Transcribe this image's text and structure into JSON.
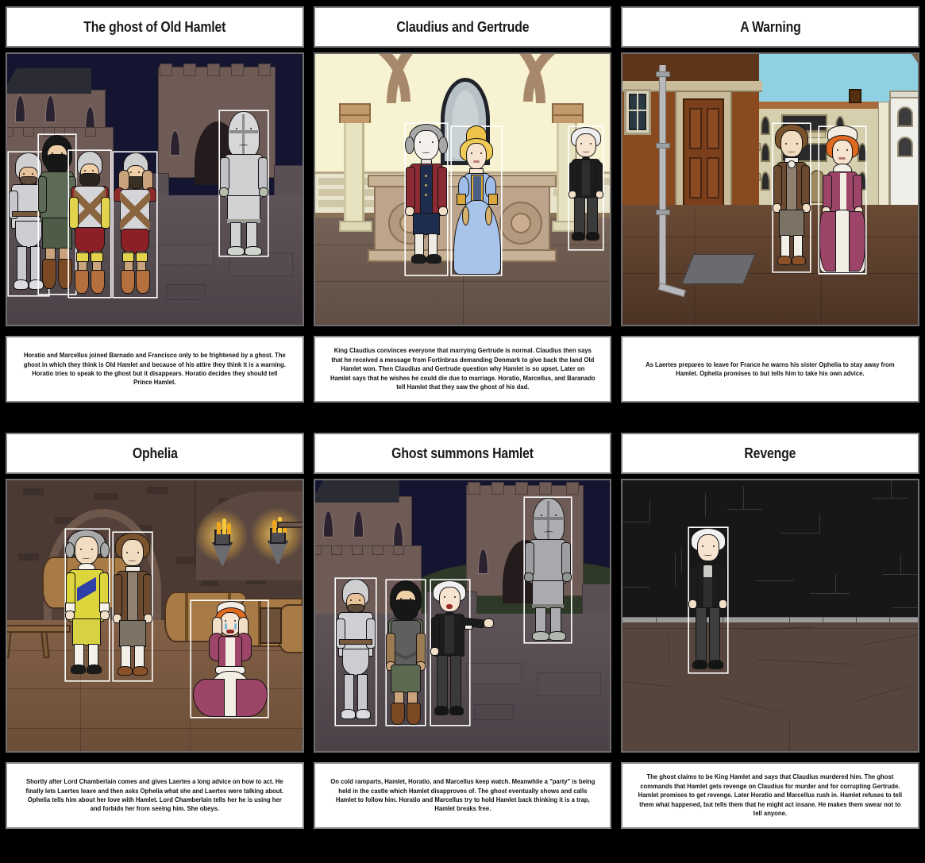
{
  "document": {
    "type": "storyboard",
    "layout": {
      "rows": 2,
      "columns": 3
    },
    "background_color": "#000000",
    "panel_background": "#ffffff"
  },
  "panels": [
    {
      "id": "panel-1",
      "title": "The ghost of Old Hamlet",
      "description": "Horatio and Marcellus joined Barnado and Francisco only to be frightened by a ghost. The ghost in which they think is Old Hamlet and because of his attire they think it is a warning. Horatio tries to speak to the ghost but it disappears. Horatio decides they should tell Prince Hamlet.",
      "scene": {
        "setting": "castle-ramparts-night",
        "sky_color": "#151531",
        "characters": [
          "armored-knight",
          "bearded-guard-green",
          "soldier-red-yellow",
          "frightened-soldier",
          "ghost-armor-white"
        ]
      }
    },
    {
      "id": "panel-2",
      "title": "Claudius and Gertrude",
      "description": "King Claudius convinces everyone that marrying Gertrude is normal. Claudius then says that he received a message from Fortinbras demanding Denmark to give back the land Old Hamlet won. Then Claudius and Gertrude question why Hamlet is so upset. Later on Hamlet says that he wishes he could die due to marriage. Horatio, Marcellus, and Baranado tell Hamlet that they saw the ghost of his dad.",
      "scene": {
        "setting": "great-hall-tomb",
        "sky_color": "#f7f2d2",
        "characters": [
          "claudius-red-coat",
          "gertrude-blue-gown",
          "hamlet-black-suit"
        ]
      }
    },
    {
      "id": "panel-3",
      "title": "A Warning",
      "description": "As Laertes prepares to leave for France he warns his sister Ophelia to stay away from Hamlet. Ophelia promises to but tells him to take his own advice.",
      "scene": {
        "setting": "street-doorway-day",
        "sky_color": "#8fd0e2",
        "characters": [
          "laertes-brown-coat",
          "ophelia-magenta-dress"
        ]
      }
    },
    {
      "id": "panel-4",
      "title": "Ophelia",
      "description": "Shortly after Lord Chamberlain comes and gives Laertes a long advice on how to act. He finally lets Laertes leave and then asks Ophelia what she and Laertes were talking about. Ophelia tells him about her love with Hamlet. Lord Chamberlain tells her he is using her and forbids her from seeing him. She obeys.",
      "scene": {
        "setting": "cellar-barrels-torches",
        "sky_color": "#4a3a33",
        "characters": [
          "lord-chamberlain-yellow",
          "laertes-brown-coat",
          "ophelia-kneeling-crying"
        ]
      }
    },
    {
      "id": "panel-5",
      "title": "Ghost summons Hamlet",
      "description": "On cold ramparts, Hamlet, Horatio, and Marcellus keep watch. Meanwhile a \"party\" is being held in the castle which Hamlet disapproves of. The ghost eventually shows and calls Hamlet to follow him. Horatio and Marcellus try to hold Hamlet back thinking it is a trap, Hamlet breaks free.",
      "scene": {
        "setting": "castle-ramparts-night",
        "sky_color": "#151531",
        "characters": [
          "marcellus-armor",
          "horatio-green-tunic",
          "hamlet-black-suit-pointing",
          "ghost-armor-white"
        ]
      }
    },
    {
      "id": "panel-6",
      "title": "Revenge",
      "description": "The ghost claims to be King Hamlet and says that Claudius murdered him. The ghost commands that Hamlet gets revenge on Claudius for murder and for corrupting Gertrude. Hamlet promises to get revenge. Later Horatio and Marcellus rush in. Hamlet refuses to tell them what happened, but tells them that he might act insane. He makes them swear not to tell anyone.",
      "scene": {
        "setting": "dark-stone-wall",
        "sky_color": "#171717",
        "characters": [
          "hamlet-black-suit"
        ]
      }
    }
  ]
}
